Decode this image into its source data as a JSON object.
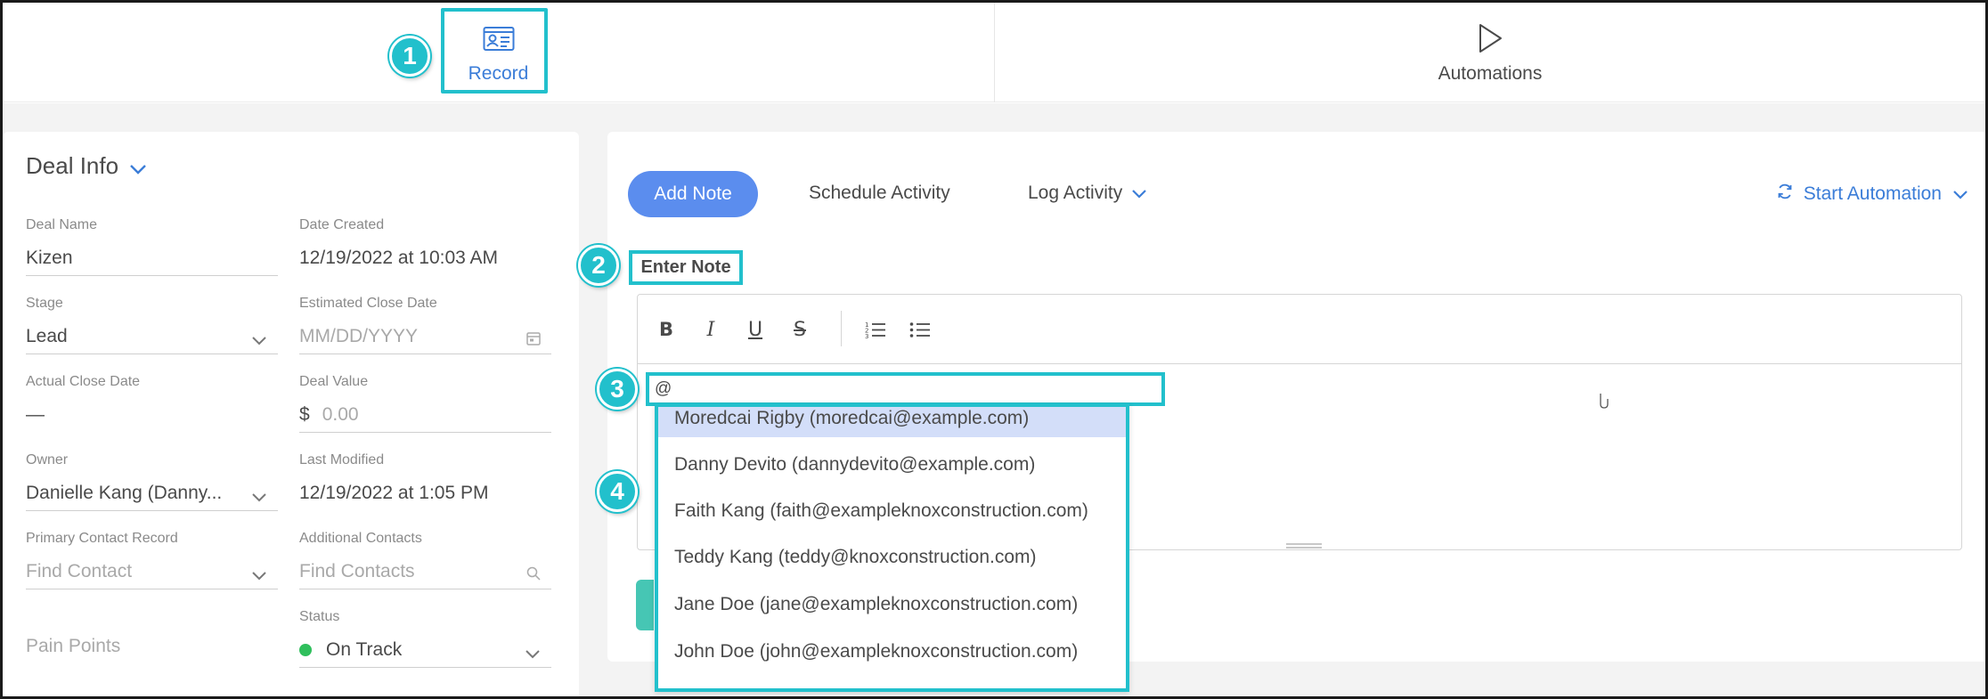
{
  "tabs": [
    {
      "label": "Record",
      "icon": "id-card-icon",
      "active": true
    },
    {
      "label": "Automations",
      "icon": "play-icon",
      "active": false
    }
  ],
  "callouts": [
    "1",
    "2",
    "3",
    "4"
  ],
  "deal_info": {
    "title": "Deal Info",
    "fields": {
      "deal_name": {
        "label": "Deal Name",
        "value": "Kizen"
      },
      "date_created": {
        "label": "Date Created",
        "value": "12/19/2022 at 10:03 AM"
      },
      "stage": {
        "label": "Stage",
        "value": "Lead"
      },
      "est_close": {
        "label": "Estimated Close Date",
        "placeholder": "MM/DD/YYYY"
      },
      "actual_close": {
        "label": "Actual Close Date",
        "value": "—"
      },
      "deal_value": {
        "label": "Deal Value",
        "currency": "$",
        "placeholder": "0.00"
      },
      "owner": {
        "label": "Owner",
        "value": "Danielle Kang (Danny..."
      },
      "last_modified": {
        "label": "Last Modified",
        "value": "12/19/2022 at 1:05 PM"
      },
      "primary_contact": {
        "label": "Primary Contact Record",
        "placeholder": "Find Contact"
      },
      "additional_contacts": {
        "label": "Additional Contacts",
        "placeholder": "Find Contacts"
      },
      "status": {
        "label": "Status",
        "value": "On Track",
        "color": "#2fbf5c"
      },
      "pain_points": {
        "label": "Pain Points"
      }
    }
  },
  "activity": {
    "add_note": "Add Note",
    "schedule_activity": "Schedule Activity",
    "log_activity": "Log Activity",
    "start_automation": "Start Automation"
  },
  "note": {
    "heading": "Enter Note",
    "tools": [
      "B",
      "I",
      "U",
      "S"
    ],
    "mention_value": "@"
  },
  "mentions": [
    "Moredcai Rigby (moredcai@example.com)",
    "Danny Devito (dannydevito@example.com)",
    "Faith Kang (faith@exampleknoxconstruction.com)",
    "Teddy Kang (teddy@knoxconstruction.com)",
    "Jane Doe (jane@exampleknoxconstruction.com)",
    "John Doe (john@exampleknoxconstruction.com)"
  ],
  "colors": {
    "accent": "#3b7dd8",
    "primary_button": "#5b8dee",
    "callout": "#22c0cc",
    "highlight_row": "#d3def9"
  }
}
